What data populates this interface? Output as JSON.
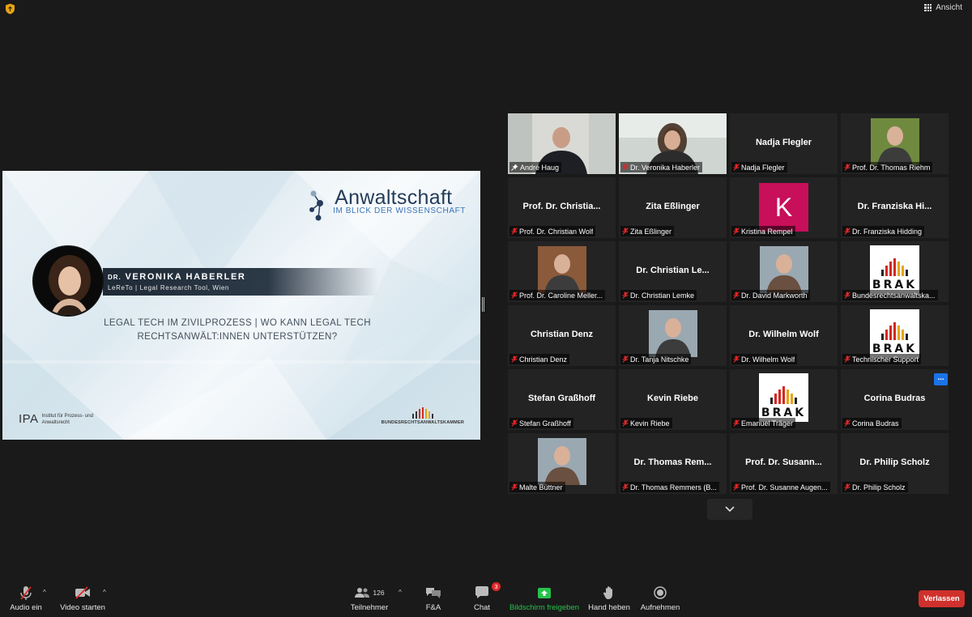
{
  "top_bar": {
    "view_label": "Ansicht",
    "security_icon": "shield-icon"
  },
  "slide": {
    "brand_title": "Anwaltschaft",
    "brand_subtitle": "IM BLICK DER WISSENSCHAFT",
    "speaker_prefix": "DR.",
    "speaker_name": "VERONIKA HABERLER",
    "speaker_affiliation": "LeReTo | Legal Research Tool, Wien",
    "topic_line1": "Legal Tech im Zivilprozess | Wo kann Legal Tech",
    "topic_line2": "Rechtsanwält:innen unterstützen?",
    "ipa_mark": "IPA",
    "ipa_text": "Institut für Prozess- und Anwaltsrecht",
    "footer_logo_text": "BUNDESRECHTSANWALTSKAMMER"
  },
  "participants": [
    {
      "name": "André Haug",
      "kind": "video",
      "pinned": true,
      "active": true
    },
    {
      "name": "Dr. Veronika Haberler",
      "kind": "video"
    },
    {
      "name": "Nadja Flegler",
      "display": "Nadja Flegler",
      "kind": "name"
    },
    {
      "name": "Prof. Dr. Thomas Riehm",
      "kind": "photo"
    },
    {
      "name": "Prof. Dr. Christian Wolf",
      "display": "Prof. Dr. Christia...",
      "kind": "name"
    },
    {
      "name": "Zita Eßlinger",
      "display": "Zita Eßlinger",
      "kind": "name"
    },
    {
      "name": "Kristina Rempel",
      "kind": "initial",
      "initial": "K"
    },
    {
      "name": "Dr. Franziska Hidding",
      "display": "Dr. Franziska Hi...",
      "kind": "name"
    },
    {
      "name": "Prof. Dr. Caroline Meller...",
      "kind": "photo"
    },
    {
      "name": "Dr. Christian Lemke",
      "display": "Dr. Christian Le...",
      "kind": "name"
    },
    {
      "name": "Dr. David Markworth",
      "kind": "photo"
    },
    {
      "name": "Bundesrechtsanwaltska...",
      "kind": "brak"
    },
    {
      "name": "Christian Denz",
      "display": "Christian Denz",
      "kind": "name"
    },
    {
      "name": "Dr. Tanja Nitschke",
      "kind": "photo"
    },
    {
      "name": "Dr. Wilhelm Wolf",
      "display": "Dr. Wilhelm Wolf",
      "kind": "name"
    },
    {
      "name": "Technischer Support",
      "kind": "brak"
    },
    {
      "name": "Stefan Graßhoff",
      "display": "Stefan Graßhoff",
      "kind": "name"
    },
    {
      "name": "Kevin Riebe",
      "display": "Kevin Riebe",
      "kind": "name"
    },
    {
      "name": "Emanuel Träger",
      "kind": "brak"
    },
    {
      "name": "Corina Budras",
      "display": "Corina Budras",
      "kind": "name"
    },
    {
      "name": "Malte Büttner",
      "kind": "photo"
    },
    {
      "name": "Dr. Thomas Remmers (B...",
      "display": "Dr. Thomas Rem...",
      "kind": "name"
    },
    {
      "name": "Prof. Dr. Susanne Augen...",
      "display": "Prof. Dr. Susann...",
      "kind": "name"
    },
    {
      "name": "Dr. Philip Scholz",
      "display": "Dr. Philip Scholz",
      "kind": "name"
    }
  ],
  "brak_word": "BRAK",
  "more_options_label": "...",
  "toolbar": {
    "audio_label": "Audio ein",
    "video_label": "Video starten",
    "participants_label": "Teilnehmer",
    "participants_count": "126",
    "qa_label": "F&A",
    "chat_label": "Chat",
    "chat_badge": "3",
    "share_label": "Bildschirm freigeben",
    "raise_hand_label": "Hand heben",
    "record_label": "Aufnehmen",
    "leave_label": "Verlassen"
  },
  "colors": {
    "active_speaker": "#cde04f",
    "leave": "#d0312d",
    "share": "#26c24b",
    "brak_red": "#d12b22"
  }
}
